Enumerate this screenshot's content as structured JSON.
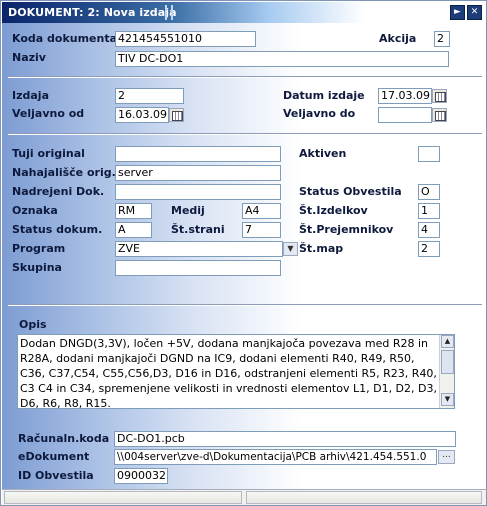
{
  "window": {
    "title": "DOKUMENT: 2: Nova izdaja"
  },
  "titlebar": {
    "play_glyph": "►",
    "close_glyph": "✕"
  },
  "section1": {
    "koda_label": "Koda dokumenta",
    "koda_value": "421454551010",
    "akcija_label": "Akcija",
    "akcija_value": "2",
    "naziv_label": "Naziv",
    "naziv_value": "TIV DC-DO1"
  },
  "section2": {
    "izdaja_label": "Izdaja",
    "izdaja_value": "2",
    "datum_izdaje_label": "Datum izdaje",
    "datum_izdaje_value": "17.03.09",
    "veljavno_od_label": "Veljavno od",
    "veljavno_od_value": "16.03.09",
    "veljavno_do_label": "Veljavno do",
    "veljavno_do_value": ""
  },
  "section3": {
    "tuji_original_label": "Tuji original",
    "tuji_original_value": "",
    "aktiven_label": "Aktiven",
    "aktiven_value": "",
    "nahajalisce_label": "Nahajališče orig.",
    "nahajalisce_value": "server",
    "nadrejeni_label": "Nadrejeni Dok.",
    "nadrejeni_value": "",
    "status_obvestila_label": "Status Obvestila",
    "status_obvestila_value": "O",
    "oznaka_label": "Oznaka",
    "oznaka_value": "RM",
    "medij_label": "Medij",
    "medij_value": "A4",
    "st_izdelkov_label": "Št.Izdelkov",
    "st_izdelkov_value": "1",
    "status_dokum_label": "Status dokum.",
    "status_dokum_value": "A",
    "st_strani_label": "Št.strani",
    "st_strani_value": "7",
    "st_prejemnikov_label": "Št.Prejemnikov",
    "st_prejemnikov_value": "4",
    "program_label": "Program",
    "program_value": "ZVE",
    "st_map_label": "Št.map",
    "st_map_value": "2",
    "skupina_label": "Skupina",
    "skupina_value": ""
  },
  "opis": {
    "label": "Opis",
    "lines": [
      "Dodan DNGD(3,3V), ločen +5V, dodana manjkajoča povezava med R28 in",
      "R28A, dodani manjkajoči DGND na IC9, dodani elementi R40, R49, R50,",
      "C36, C37,C54, C55,C56,D3, D16 in D16, odstranjeni elementi R5, R23, R40,",
      "C3 C4 in C34, spremenjene velikosti in vrednosti elementov L1, D1, D2, D3,",
      "D6, R6, R8, R15."
    ]
  },
  "section4": {
    "racunaln_koda_label": "Računaln.koda",
    "racunaln_koda_value": "DC-DO1.pcb",
    "edokument_label": "eDokument",
    "edokument_value": "\\\\004server\\zve-d\\Dokumentacija\\PCB arhiv\\421.454.551.0",
    "id_obvestila_label": "ID Obvestila",
    "id_obvestila_value": "0900032"
  },
  "icons": {
    "calendar": "calendar-icon",
    "dropdown": "chevron-down-icon",
    "browse": "ellipsis-icon",
    "scroll_up": "arrow-up-icon",
    "scroll_down": "arrow-down-icon"
  }
}
